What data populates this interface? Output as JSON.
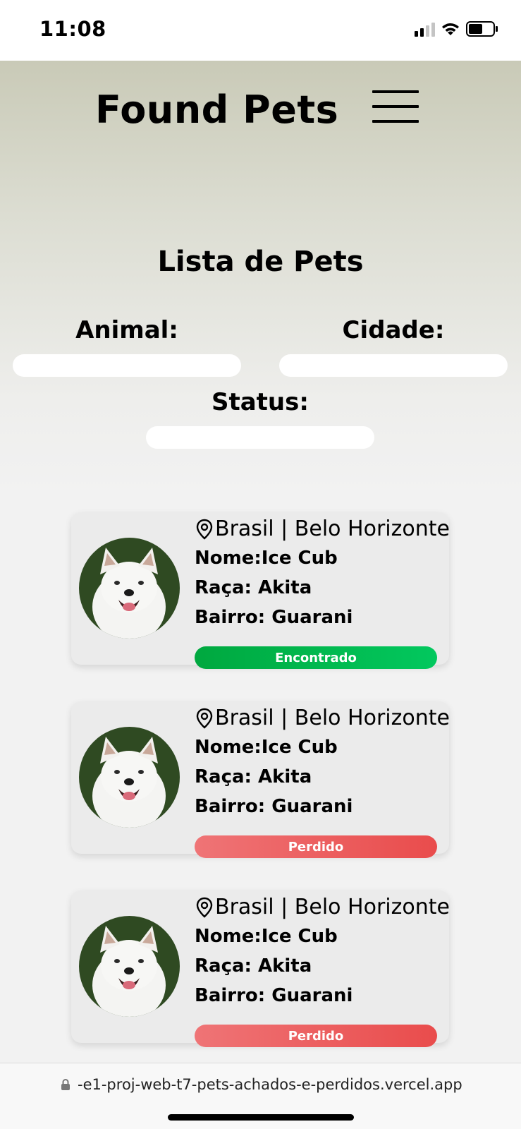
{
  "status_bar": {
    "time": "11:08"
  },
  "header": {
    "title": "Found Pets"
  },
  "list": {
    "title": "Lista de Pets"
  },
  "filters": {
    "animal_label": "Animal:",
    "cidade_label": "Cidade:",
    "status_label": "Status:",
    "animal_value": "",
    "cidade_value": "",
    "status_value": ""
  },
  "cards": [
    {
      "location": "Brasil | Belo Horizonte",
      "nome": "Nome:Ice Cub",
      "raca": "Raça: Akita",
      "bairro": "Bairro: Guarani",
      "status": "Encontrado",
      "status_color": "#00b44a"
    },
    {
      "location": "Brasil | Belo Horizonte",
      "nome": "Nome:Ice Cub",
      "raca": "Raça: Akita",
      "bairro": "Bairro: Guarani",
      "status": "Perdido",
      "status_color": "#ec5555"
    },
    {
      "location": "Brasil | Belo Horizonte",
      "nome": "Nome:Ice Cub",
      "raca": "Raça: Akita",
      "bairro": "Bairro: Guarani",
      "status": "Perdido",
      "status_color": "#ec5555"
    }
  ],
  "browser": {
    "url": "-e1-proj-web-t7-pets-achados-e-perdidos.vercel.app"
  },
  "icons": {
    "menu": "hamburger-icon",
    "location": "map-pin-icon",
    "lock": "lock-icon"
  }
}
